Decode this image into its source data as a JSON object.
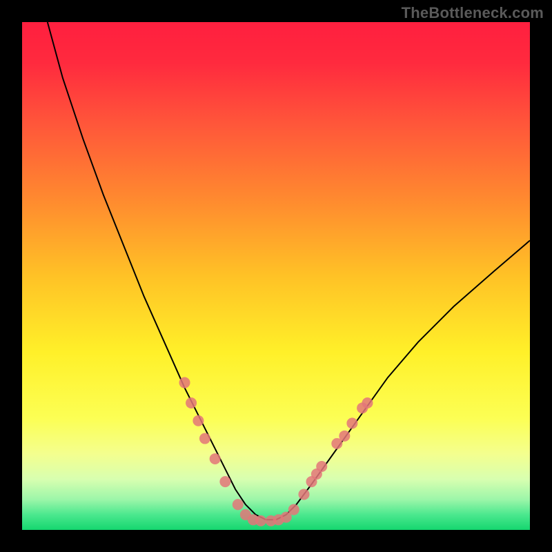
{
  "watermark": "TheBottleneck.com",
  "chart_data": {
    "type": "line",
    "title": "",
    "xlabel": "",
    "ylabel": "",
    "xlim": [
      0,
      100
    ],
    "ylim": [
      0,
      100
    ],
    "background_gradient_stops": [
      {
        "offset": 0.0,
        "color": "#ff1f3f"
      },
      {
        "offset": 0.08,
        "color": "#ff2a3e"
      },
      {
        "offset": 0.2,
        "color": "#ff563a"
      },
      {
        "offset": 0.35,
        "color": "#ff8a2f"
      },
      {
        "offset": 0.5,
        "color": "#ffc226"
      },
      {
        "offset": 0.65,
        "color": "#fff029"
      },
      {
        "offset": 0.78,
        "color": "#fcff54"
      },
      {
        "offset": 0.85,
        "color": "#f4ff8e"
      },
      {
        "offset": 0.9,
        "color": "#d8ffb0"
      },
      {
        "offset": 0.94,
        "color": "#9cf6a9"
      },
      {
        "offset": 0.97,
        "color": "#4be88e"
      },
      {
        "offset": 1.0,
        "color": "#15d66f"
      }
    ],
    "series": [
      {
        "name": "bottleneck-curve",
        "color": "#000000",
        "x": [
          5,
          8,
          12,
          16,
          20,
          24,
          28,
          32,
          34,
          36,
          38,
          40,
          42,
          44,
          46,
          48,
          50,
          52,
          54,
          57,
          62,
          67,
          72,
          78,
          85,
          93,
          100
        ],
        "y": [
          100,
          89,
          77,
          66,
          56,
          46,
          37,
          28,
          24,
          20,
          16,
          12,
          8,
          5,
          3,
          2,
          2,
          3,
          5,
          9,
          16,
          23,
          30,
          37,
          44,
          51,
          57
        ]
      }
    ],
    "scatter": {
      "name": "sample-points",
      "color": "#e37679",
      "radius_px": 8,
      "points": [
        {
          "x": 32.0,
          "y": 29.0
        },
        {
          "x": 33.3,
          "y": 25.0
        },
        {
          "x": 34.7,
          "y": 21.5
        },
        {
          "x": 36.0,
          "y": 18.0
        },
        {
          "x": 38.0,
          "y": 14.0
        },
        {
          "x": 40.0,
          "y": 9.5
        },
        {
          "x": 42.5,
          "y": 5.0
        },
        {
          "x": 44.0,
          "y": 3.0
        },
        {
          "x": 45.5,
          "y": 2.0
        },
        {
          "x": 47.0,
          "y": 1.8
        },
        {
          "x": 49.0,
          "y": 1.8
        },
        {
          "x": 50.5,
          "y": 2.0
        },
        {
          "x": 52.0,
          "y": 2.5
        },
        {
          "x": 53.5,
          "y": 4.0
        },
        {
          "x": 55.5,
          "y": 7.0
        },
        {
          "x": 57.0,
          "y": 9.5
        },
        {
          "x": 58.0,
          "y": 11.0
        },
        {
          "x": 59.0,
          "y": 12.5
        },
        {
          "x": 62.0,
          "y": 17.0
        },
        {
          "x": 63.5,
          "y": 18.5
        },
        {
          "x": 65.0,
          "y": 21.0
        },
        {
          "x": 67.0,
          "y": 24.0
        },
        {
          "x": 68.0,
          "y": 25.0
        }
      ]
    }
  }
}
